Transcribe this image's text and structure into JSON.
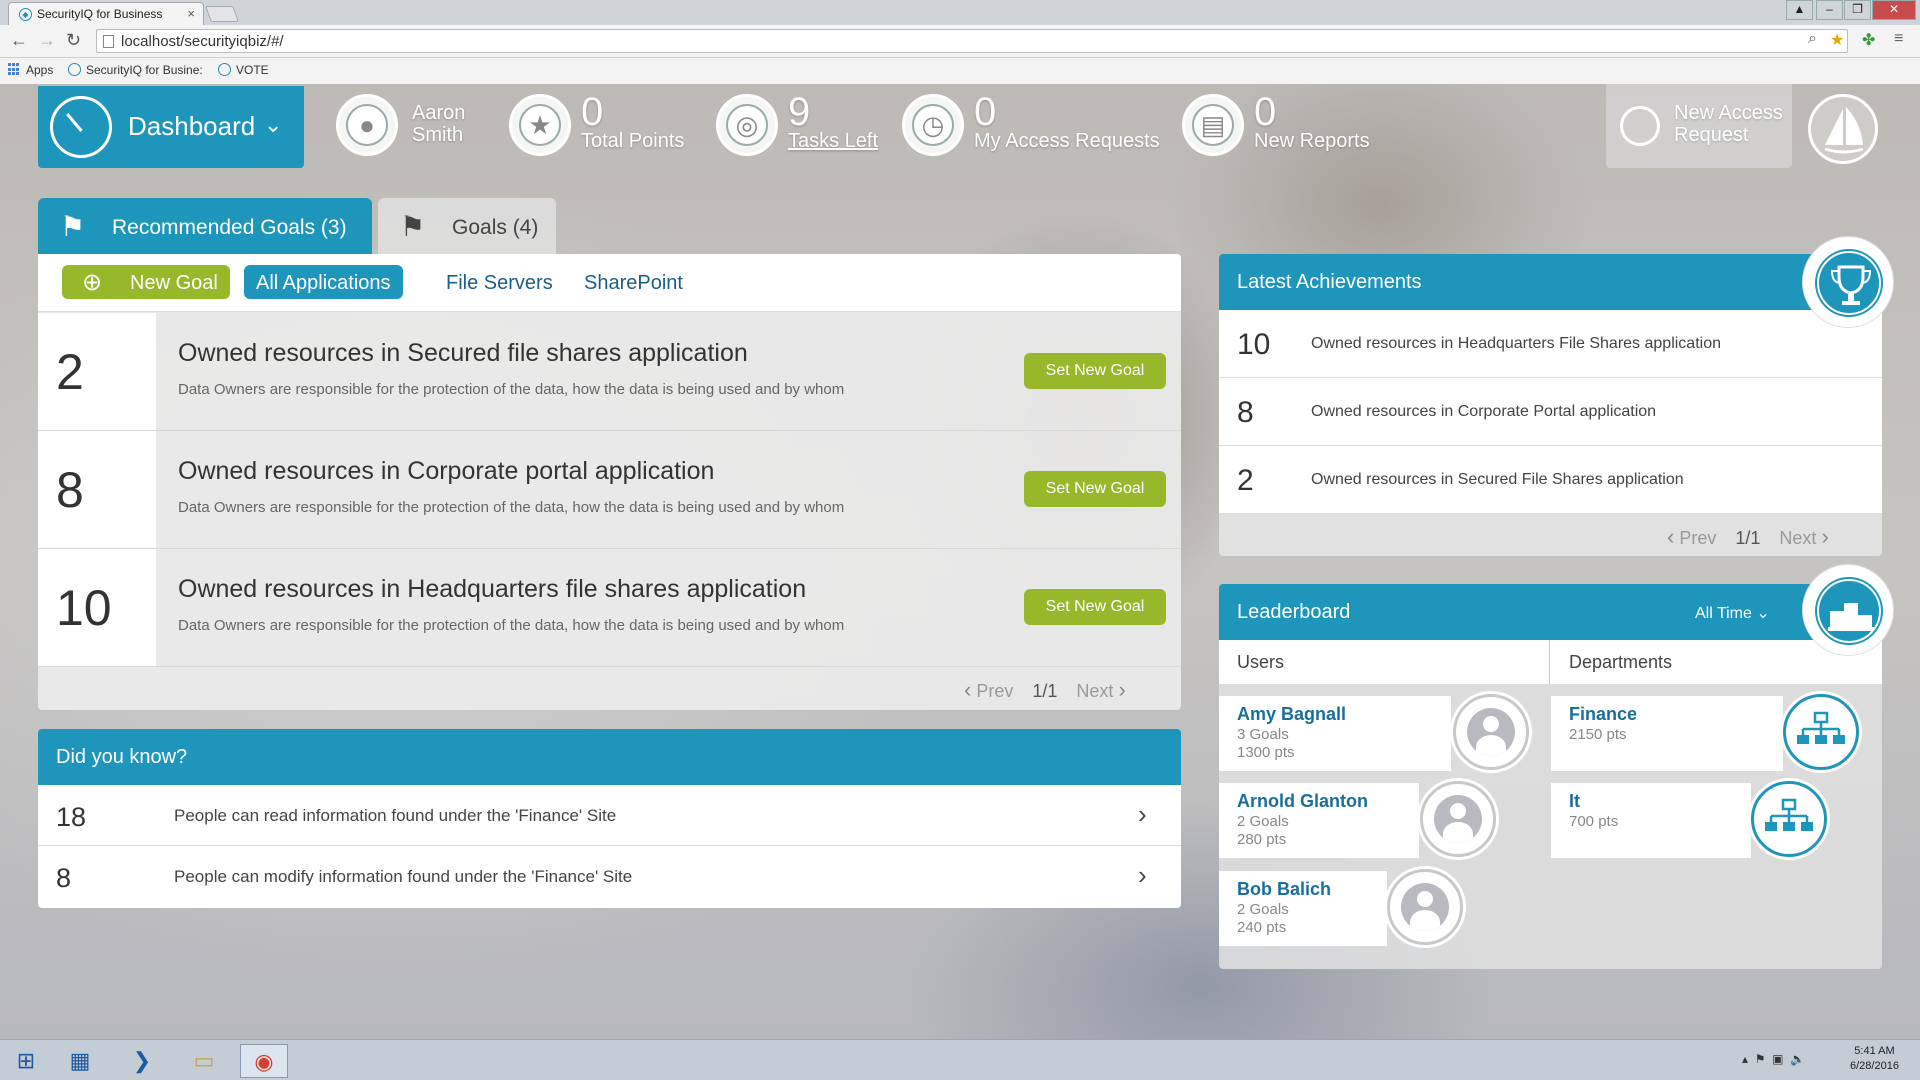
{
  "browser": {
    "tab_title": "SecurityIQ for Business",
    "tab_close": "×",
    "url": "localhost/securityiqbiz/#/",
    "bookmarks": [
      "Apps",
      "SecurityIQ for Busine:",
      "VOTE"
    ]
  },
  "header": {
    "dashboard_label": "Dashboard",
    "user": {
      "first": "Aaron",
      "last": "Smith"
    },
    "stats": [
      {
        "value": "0",
        "label": "Total Points",
        "icon": "star-icon"
      },
      {
        "value": "9",
        "label": "Tasks Left",
        "icon": "target-icon"
      },
      {
        "value": "0",
        "label": "My Access Requests",
        "icon": "clock-icon"
      },
      {
        "value": "0",
        "label": "New Reports",
        "icon": "document-icon"
      }
    ],
    "new_access_request": {
      "line1": "New Access",
      "line2": "Request"
    }
  },
  "goals": {
    "tabs": [
      {
        "label": "Recommended Goals (3)",
        "active": true
      },
      {
        "label": "Goals (4)",
        "active": false
      }
    ],
    "filters": {
      "new_goal": "New Goal",
      "items": [
        "All Applications",
        "File Servers",
        "SharePoint"
      ]
    },
    "rows": [
      {
        "number": "2",
        "title": "Owned resources in Secured file shares application",
        "desc": "Data Owners are responsible for the protection of the data, how the data is being used and by whom",
        "button": "Set New Goal"
      },
      {
        "number": "8",
        "title": "Owned resources in Corporate portal application",
        "desc": "Data Owners are responsible for the protection of the data, how the data is being used and by whom",
        "button": "Set New Goal"
      },
      {
        "number": "10",
        "title": "Owned resources in Headquarters file shares application",
        "desc": "Data Owners are responsible for the protection of the data, how the data is being used and by whom",
        "button": "Set New Goal"
      }
    ],
    "pager": {
      "prev": "Prev",
      "page": "1/1",
      "next": "Next"
    }
  },
  "did_you_know": {
    "title": "Did you know?",
    "rows": [
      {
        "number": "18",
        "text": "People can read information found under the 'Finance' Site"
      },
      {
        "number": "8",
        "text": "People can modify information found under the 'Finance' Site"
      }
    ]
  },
  "achievements": {
    "title": "Latest Achievements",
    "rows": [
      {
        "number": "10",
        "text": "Owned resources in Headquarters File Shares application"
      },
      {
        "number": "8",
        "text": "Owned resources in Corporate Portal application"
      },
      {
        "number": "2",
        "text": "Owned resources in Secured File Shares application"
      }
    ],
    "pager": {
      "prev": "Prev",
      "page": "1/1",
      "next": "Next"
    }
  },
  "leaderboard": {
    "title": "Leaderboard",
    "period": "All Time",
    "columns": {
      "users": "Users",
      "departments": "Departments"
    },
    "users": [
      {
        "name": "Amy Bagnall",
        "goals": "3 Goals",
        "points": "1300 pts"
      },
      {
        "name": "Arnold Glanton",
        "goals": "2 Goals",
        "points": "280 pts"
      },
      {
        "name": "Bob Balich",
        "goals": "2 Goals",
        "points": "240 pts"
      }
    ],
    "departments": [
      {
        "name": "Finance",
        "points": "2150 pts"
      },
      {
        "name": "It",
        "points": "700 pts"
      }
    ]
  },
  "taskbar": {
    "time": "5:41 AM",
    "date": "6/28/2016"
  },
  "colors": {
    "accent": "#1e95bb",
    "green": "#97b82a"
  }
}
